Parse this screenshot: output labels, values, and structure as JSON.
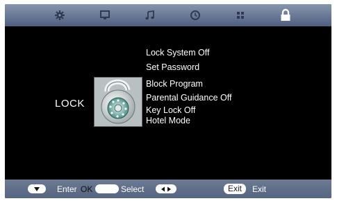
{
  "tabs": [
    {
      "icon": "gear-icon",
      "active": false
    },
    {
      "icon": "monitor-icon",
      "active": false
    },
    {
      "icon": "music-note-icon",
      "active": false
    },
    {
      "icon": "clock-icon",
      "active": false
    },
    {
      "icon": "grid-icon",
      "active": false
    },
    {
      "icon": "padlock-icon",
      "active": true
    }
  ],
  "page": {
    "label": "LOCK",
    "graphic": "combination-lock-icon"
  },
  "menu": [
    "Lock System Off",
    "Set Password",
    "Block Program",
    "Parental Guidance Off",
    "Key Lock Off",
    "Hotel Mode"
  ],
  "footer": {
    "enter_label": "Enter",
    "ok_label": "OK",
    "select_label": "Select",
    "exit_key_label": "Exit",
    "exit_label": "Exit"
  },
  "colors": {
    "topbar": "#6f7d99",
    "background": "#000000",
    "text": "#ffffff"
  }
}
